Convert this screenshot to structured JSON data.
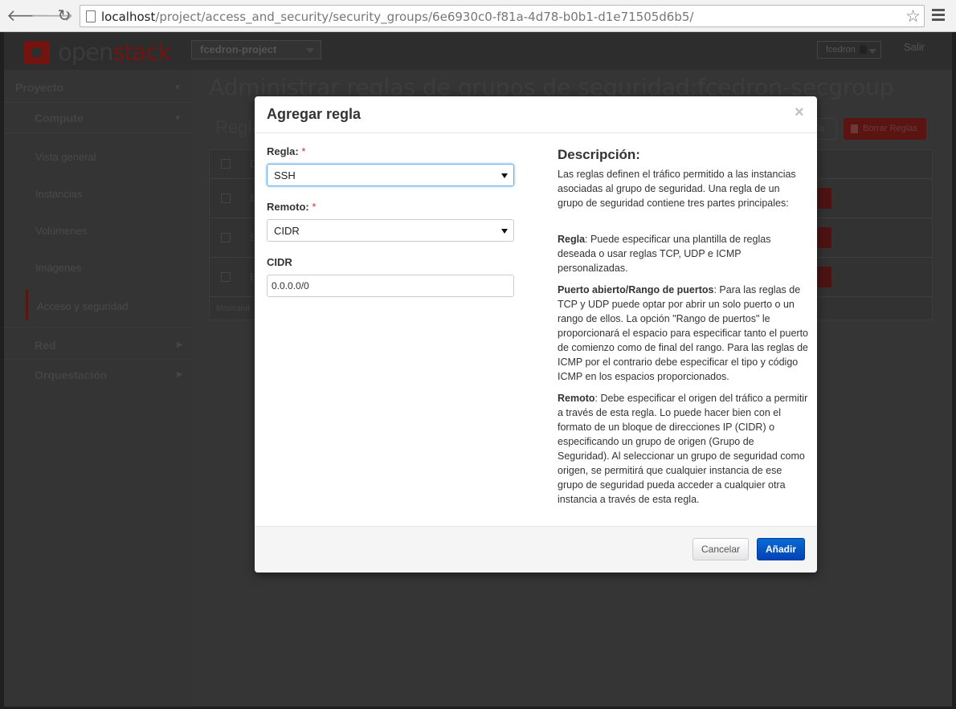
{
  "browser": {
    "url_host": "localhost",
    "url_path": "/project/access_and_security/security_groups/6e6930c0-f81a-4d78-b0b1-d1e71505d6b5/",
    "back_glyph": "🡐",
    "forward_glyph": "🡒",
    "reload_glyph": "↻",
    "star_glyph": "☆"
  },
  "header": {
    "logo_open": "open",
    "logo_stack": "stack",
    "project": "fcedron-project",
    "user": "fcedron",
    "logout": "Salir"
  },
  "sidebar": {
    "section": "Proyecto",
    "compute": "Compute",
    "items": [
      "Vista general",
      "Instancias",
      "Volúmenes",
      "Imágenes",
      "Acceso y seguridad"
    ],
    "network": "Red",
    "orchestration": "Orquestación"
  },
  "main": {
    "title": "Administrar reglas de grupos de seguridad:fcedron-secgroup",
    "subtitle": "Regla",
    "delete_rules": "Borrar Reglas",
    "add_rule_fragment": "la",
    "col_fragment": "D",
    "row_fragments": [
      "S",
      "S",
      "E"
    ],
    "footer_fragment": "Mostrand"
  },
  "modal": {
    "title": "Agregar regla",
    "close": "×",
    "rule_label": "Regla:",
    "remote_label": "Remoto:",
    "cidr_label": "CIDR",
    "required_mark": "*",
    "rule_value": "SSH",
    "remote_value": "CIDR",
    "cidr_value": "0.0.0.0/0",
    "desc_title": "Descripción:",
    "desc_intro": "Las reglas definen el tráfico permitido a las instancias asociadas al grupo de seguridad. Una regla de un grupo de seguridad contiene tres partes principales:",
    "desc_rule_term": "Regla",
    "desc_rule_text": ": Puede especificar una plantilla de reglas deseada o usar reglas TCP, UDP e ICMP personalizadas.",
    "desc_port_term": "Puerto abierto/Rango de puertos",
    "desc_port_text": ": Para las reglas de TCP y UDP puede optar por abrir un solo puerto o un rango de ellos. La opción \"Rango de puertos\" le proporcionará el espacio para especificar tanto el puerto de comienzo como de final del rango. Para las reglas de ICMP por el contrario debe especificar el tipo y código ICMP en los espacios proporcionados.",
    "desc_remote_term": "Remoto",
    "desc_remote_text": ": Debe especificar el origen del tráfico a permitir a través de esta regla. Lo puede hacer bien con el formato de un bloque de direcciones IP (CIDR) o especificando un grupo de origen (Grupo de Seguridad). Al seleccionar un grupo de seguridad como origen, se permitirá que cualquier instancia de ese grupo de seguridad pueda acceder a cualquier otra instancia a través de esta regla.",
    "cancel": "Cancelar",
    "add": "Añadir"
  },
  "colors": {
    "primary_button": "#0055cc",
    "brand_red": "#741410",
    "required": "#c9302c"
  }
}
